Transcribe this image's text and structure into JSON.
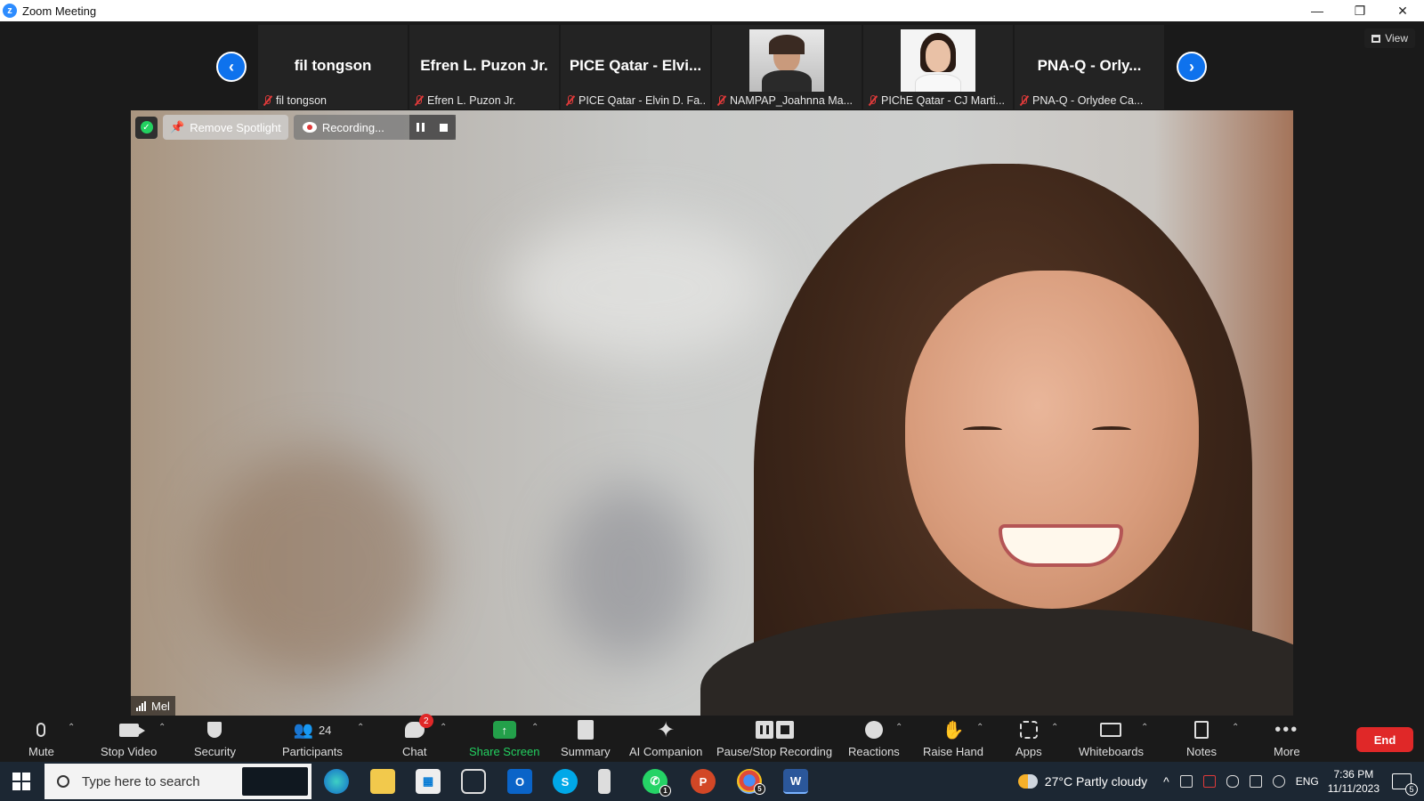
{
  "window": {
    "title": "Zoom Meeting",
    "minimize": "—",
    "restore": "❐",
    "close": "✕"
  },
  "stage": {
    "view_label": "View",
    "prev": "‹",
    "next": "›",
    "participants": [
      {
        "big_name": "fil tongson",
        "name": "fil tongson",
        "has_video": false
      },
      {
        "big_name": "Efren L. Puzon Jr.",
        "name": "Efren L. Puzon Jr.",
        "has_video": false
      },
      {
        "big_name": "PICE Qatar - Elvi...",
        "name": "PICE Qatar - Elvin D. Fa...",
        "has_video": false
      },
      {
        "big_name": "",
        "name": "NAMPAP_Joahnna Ma...",
        "has_video": true
      },
      {
        "big_name": "",
        "name": "PIChE Qatar - CJ Marti...",
        "has_video": true
      },
      {
        "big_name": "PNA-Q  -  Orly...",
        "name": "PNA-Q  -  Orlydee Ca...",
        "has_video": false
      }
    ],
    "overlay": {
      "remove_spotlight": "Remove Spotlight",
      "recording": "Recording...",
      "shield_check": "✓"
    },
    "self_name": "Mel"
  },
  "toolbar": {
    "mute": "Mute",
    "stop_video": "Stop Video",
    "security": "Security",
    "participants": "Participants",
    "participants_count": "24",
    "chat": "Chat",
    "chat_badge": "2",
    "share_screen": "Share Screen",
    "summary": "Summary",
    "ai_companion": "AI Companion",
    "pause_stop_recording": "Pause/Stop Recording",
    "reactions": "Reactions",
    "raise_hand": "Raise Hand",
    "apps": "Apps",
    "whiteboards": "Whiteboards",
    "notes": "Notes",
    "more": "More",
    "end": "End",
    "caret": "⌃"
  },
  "taskbar": {
    "search_placeholder": "Type here to search",
    "whatsapp_badge": "1",
    "chrome_badge": "5",
    "weather": "27°C  Partly cloudy",
    "language": "ENG",
    "time": "7:36 PM",
    "date": "11/11/2023",
    "notification_count": "5"
  },
  "colors": {
    "accent_blue": "#0e72ed",
    "end_red": "#e02828",
    "share_green": "#23a04a",
    "muted_red": "#e03a3a"
  }
}
